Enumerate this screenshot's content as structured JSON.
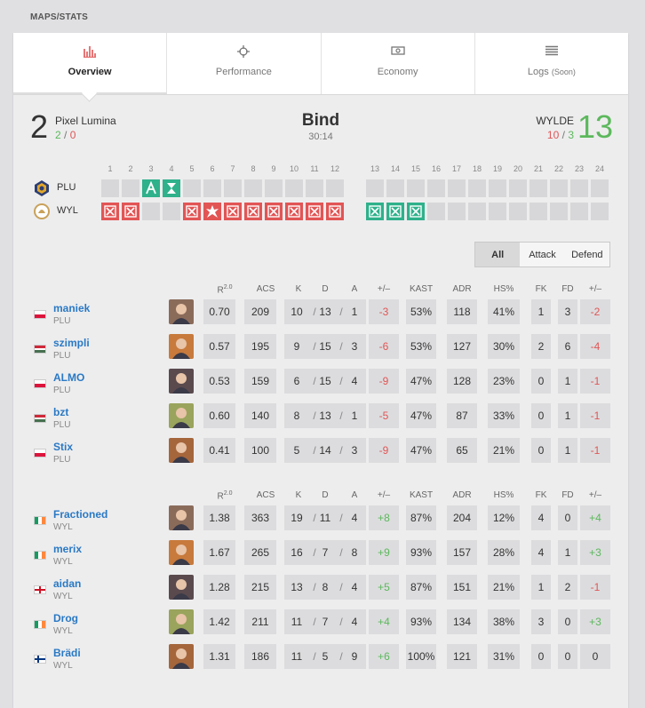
{
  "section_label": "MAPS/STATS",
  "tabs": [
    {
      "label": "Overview",
      "icon": "bar-chart-icon"
    },
    {
      "label": "Performance",
      "icon": "crosshair-icon"
    },
    {
      "label": "Economy",
      "icon": "money-icon"
    },
    {
      "label": "Logs",
      "soon": "(Soon)",
      "icon": "list-icon"
    }
  ],
  "map": {
    "name": "Bind",
    "duration": "30:14"
  },
  "team1": {
    "score": "2",
    "name": "Pixel Lumina",
    "attack": "2",
    "slash": "/",
    "defend": "0",
    "abbr": "PLU"
  },
  "team2": {
    "score": "13",
    "name": "WYLDE",
    "attack": "10",
    "slash": "/",
    "defend": "3",
    "abbr": "WYL"
  },
  "round_numbers": [
    "1",
    "2",
    "3",
    "4",
    "5",
    "6",
    "7",
    "8",
    "9",
    "10",
    "11",
    "12",
    "13",
    "14",
    "15",
    "16",
    "17",
    "18",
    "19",
    "20",
    "21",
    "22",
    "23",
    "24"
  ],
  "round_icons": {
    "team1": [
      "",
      "",
      "defuse",
      "time",
      "",
      "",
      "",
      "",
      "",
      "",
      "",
      "",
      "",
      "",
      "",
      "",
      "",
      "",
      "",
      "",
      "",
      "",
      "",
      ""
    ],
    "team2": [
      "elim",
      "elim",
      "",
      "",
      "elim",
      "boom",
      "elim",
      "elim",
      "elim",
      "elim",
      "elim",
      "elim",
      "elim",
      "elim",
      "elim",
      "",
      "",
      "",
      "",
      "",
      "",
      "",
      "",
      ""
    ]
  },
  "colors": {
    "attack_win": "#e25555",
    "defend_win": "#2fb18b",
    "link": "#2a79c4",
    "positive": "#5cb85c",
    "negative": "#e05656"
  },
  "filter": {
    "all": "All",
    "attack": "Attack",
    "defend": "Defend"
  },
  "headers": {
    "rating": "R",
    "rating_sup": "2.0",
    "acs": "ACS",
    "k": "K",
    "d": "D",
    "a": "A",
    "pm": "+/–",
    "kast": "KAST",
    "adr": "ADR",
    "hs": "HS%",
    "fk": "FK",
    "fd": "FD",
    "fkfd": "+/–"
  },
  "players_team1": [
    {
      "name": "maniek",
      "team": "PLU",
      "flag": "pl",
      "r": "0.70",
      "acs": "209",
      "k": "10",
      "d": "13",
      "a": "1",
      "pm": "-3",
      "kast": "53%",
      "adr": "118",
      "hs": "41%",
      "fk": "1",
      "fd": "3",
      "fpm": "-2"
    },
    {
      "name": "szimpli",
      "team": "PLU",
      "flag": "hu",
      "r": "0.57",
      "acs": "195",
      "k": "9",
      "d": "15",
      "a": "3",
      "pm": "-6",
      "kast": "53%",
      "adr": "127",
      "hs": "30%",
      "fk": "2",
      "fd": "6",
      "fpm": "-4"
    },
    {
      "name": "ALMO",
      "team": "PLU",
      "flag": "pl",
      "r": "0.53",
      "acs": "159",
      "k": "6",
      "d": "15",
      "a": "4",
      "pm": "-9",
      "kast": "47%",
      "adr": "128",
      "hs": "23%",
      "fk": "0",
      "fd": "1",
      "fpm": "-1"
    },
    {
      "name": "bzt",
      "team": "PLU",
      "flag": "hu",
      "r": "0.60",
      "acs": "140",
      "k": "8",
      "d": "13",
      "a": "1",
      "pm": "-5",
      "kast": "47%",
      "adr": "87",
      "hs": "33%",
      "fk": "0",
      "fd": "1",
      "fpm": "-1"
    },
    {
      "name": "Stix",
      "team": "PLU",
      "flag": "pl",
      "r": "0.41",
      "acs": "100",
      "k": "5",
      "d": "14",
      "a": "3",
      "pm": "-9",
      "kast": "47%",
      "adr": "65",
      "hs": "21%",
      "fk": "0",
      "fd": "1",
      "fpm": "-1"
    }
  ],
  "players_team2": [
    {
      "name": "Fractioned",
      "team": "WYL",
      "flag": "ie",
      "r": "1.38",
      "acs": "363",
      "k": "19",
      "d": "11",
      "a": "4",
      "pm": "+8",
      "kast": "87%",
      "adr": "204",
      "hs": "12%",
      "fk": "4",
      "fd": "0",
      "fpm": "+4"
    },
    {
      "name": "merix",
      "team": "WYL",
      "flag": "ie",
      "r": "1.67",
      "acs": "265",
      "k": "16",
      "d": "7",
      "a": "8",
      "pm": "+9",
      "kast": "93%",
      "adr": "157",
      "hs": "28%",
      "fk": "4",
      "fd": "1",
      "fpm": "+3"
    },
    {
      "name": "aidan",
      "team": "WYL",
      "flag": "en",
      "r": "1.28",
      "acs": "215",
      "k": "13",
      "d": "8",
      "a": "4",
      "pm": "+5",
      "kast": "87%",
      "adr": "151",
      "hs": "21%",
      "fk": "1",
      "fd": "2",
      "fpm": "-1"
    },
    {
      "name": "Drog",
      "team": "WYL",
      "flag": "ie",
      "r": "1.42",
      "acs": "211",
      "k": "11",
      "d": "7",
      "a": "4",
      "pm": "+4",
      "kast": "93%",
      "adr": "134",
      "hs": "38%",
      "fk": "3",
      "fd": "0",
      "fpm": "+3"
    },
    {
      "name": "Brädi",
      "team": "WYL",
      "flag": "fi",
      "r": "1.31",
      "acs": "186",
      "k": "11",
      "d": "5",
      "a": "9",
      "pm": "+6",
      "kast": "100%",
      "adr": "121",
      "hs": "31%",
      "fk": "0",
      "fd": "0",
      "fpm": "0"
    }
  ]
}
